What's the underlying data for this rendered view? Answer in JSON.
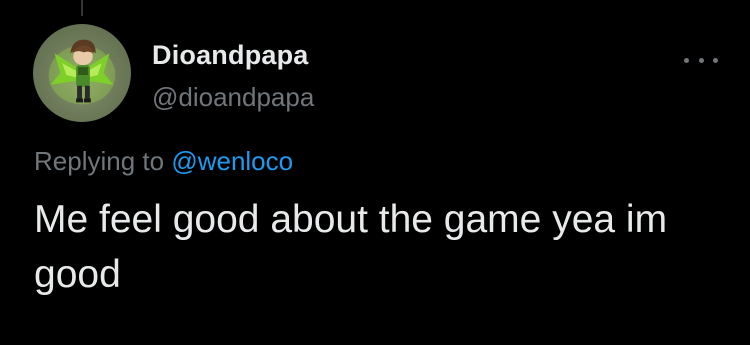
{
  "tweet": {
    "display_name": "Dioandpapa",
    "handle": "@dioandpapa",
    "replying_prefix": "Replying to ",
    "replying_to": "@wenloco",
    "text": "Me feel good about the game yea im good",
    "more_icon": "more-horizontal-icon",
    "avatar_icon": "character-avatar-icon"
  },
  "colors": {
    "background": "#000000",
    "primary_text": "#e7e9ea",
    "secondary_text": "#71767b",
    "accent": "#1d9bf0"
  }
}
